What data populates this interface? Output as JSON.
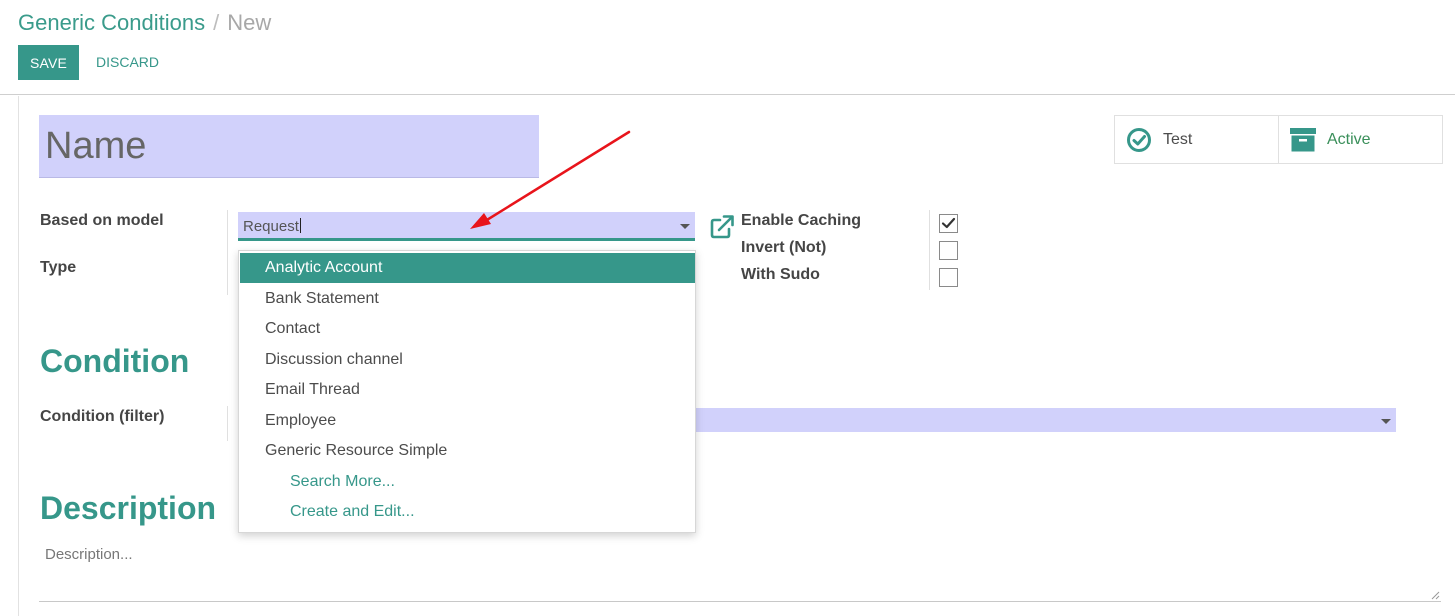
{
  "breadcrumb": {
    "parent": "Generic Conditions",
    "separator": "/",
    "current": "New"
  },
  "buttons": {
    "save": "SAVE",
    "discard": "DISCARD"
  },
  "form": {
    "name_placeholder": "Name",
    "smart_buttons": {
      "test": "Test",
      "active": "Active"
    },
    "labels": {
      "based_on_model": "Based on model",
      "type": "Type",
      "enable_caching": "Enable Caching",
      "invert": "Invert (Not)",
      "with_sudo": "With Sudo",
      "condition_filter": "Condition (filter)"
    },
    "model_value": "Request",
    "checkboxes": {
      "enable_caching": true,
      "invert": false,
      "with_sudo": false
    },
    "sections": {
      "condition": "Condition",
      "description": "Description"
    },
    "description_placeholder": "Description..."
  },
  "dropdown": {
    "items": [
      "Analytic Account",
      "Bank Statement",
      "Contact",
      "Discussion channel",
      "Email Thread",
      "Employee",
      "Generic Resource Simple"
    ],
    "selected_index": 0,
    "search_more": "Search More...",
    "create_and_edit": "Create and Edit..."
  },
  "colors": {
    "primary": "#36978a",
    "field_highlight": "#d1d1fb",
    "annotation_arrow": "#e8141b"
  }
}
